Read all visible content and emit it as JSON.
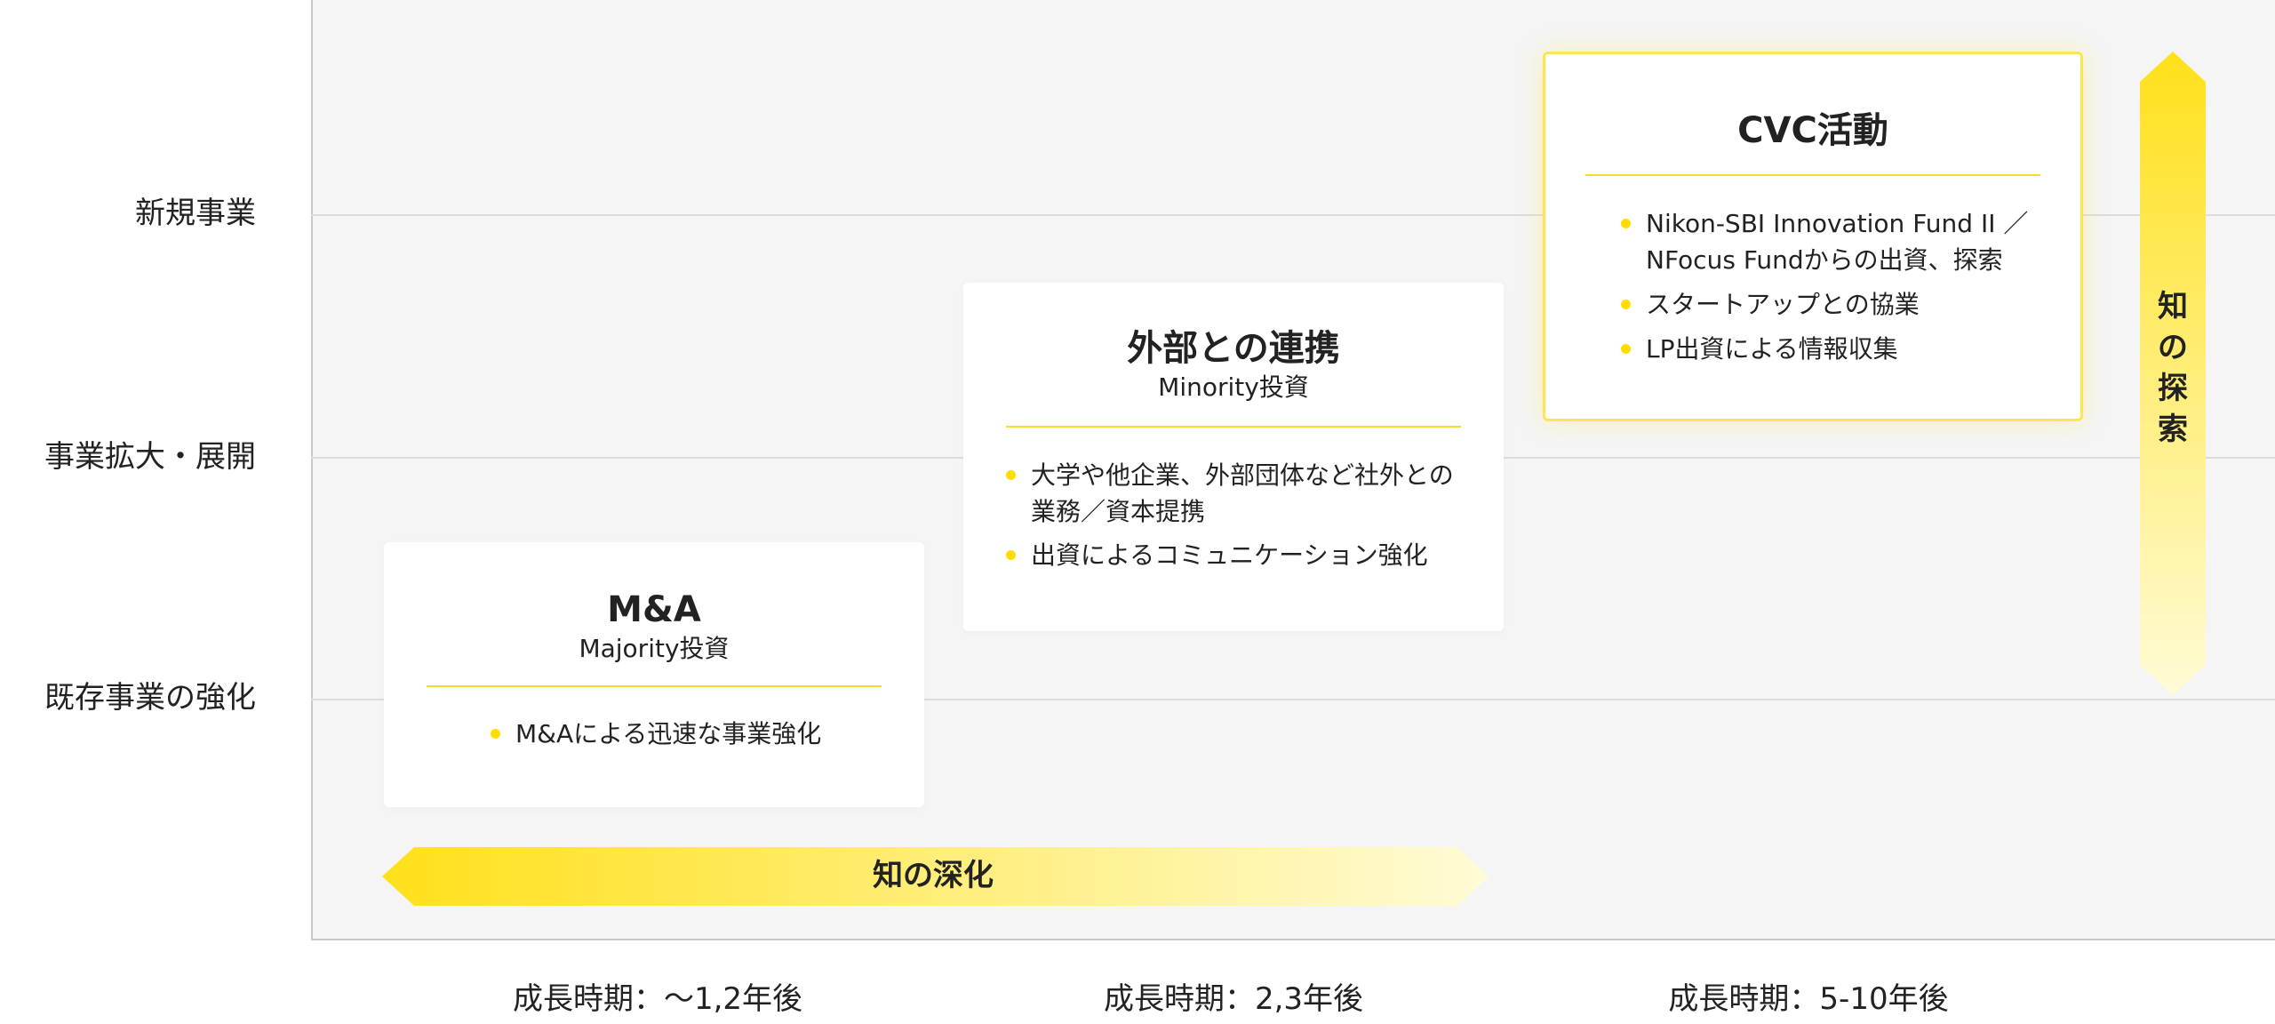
{
  "y_levels": [
    "新規事業",
    "事業拡大・展開",
    "既存事業の強化"
  ],
  "x_periods": [
    "成長時期：〜1,2年後",
    "成長時期：2,3年後",
    "成長時期：5-10年後"
  ],
  "cards": [
    {
      "title": "M&A",
      "subtitle": "Majority投資",
      "items": [
        "M&Aによる迅速な事業強化"
      ]
    },
    {
      "title": "外部との連携",
      "subtitle": "Minority投資",
      "items": [
        "大学や他企業、外部団体など社外との",
        "業務／資本提携",
        "出資によるコミュニケーション強化"
      ]
    },
    {
      "title": "CVC活動",
      "subtitle": "",
      "items": [
        "Nikon-SBI Innovation Fund II ／",
        "NFocus Fundからの出資、探索",
        "スタートアップとの協業",
        "LP出資による情報収集"
      ]
    }
  ],
  "arrows": {
    "horizontal_label": "知の深化",
    "vertical_label": [
      "知",
      "の",
      "探",
      "索"
    ]
  },
  "colors": {
    "accent": "#ffe01a",
    "accent_fade": "#fffbd6",
    "plot_bg": "#f5f5f5",
    "gridline": "#dcdcdc"
  }
}
